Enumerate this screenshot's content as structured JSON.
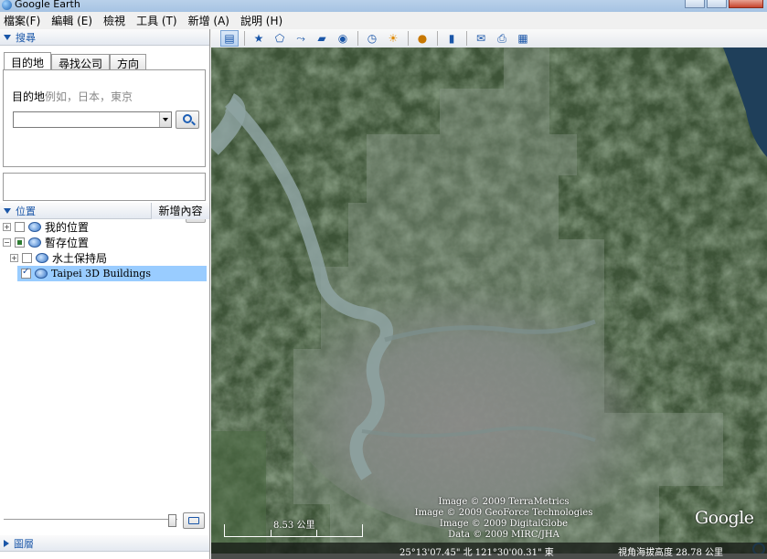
{
  "window": {
    "title": "Google Earth"
  },
  "menu": [
    "檔案(F)",
    "編輯 (E)",
    "檢視",
    "工具 (T)",
    "新增 (A)",
    "說明 (H)"
  ],
  "search": {
    "header": "搜尋",
    "tabs": [
      "目的地",
      "尋找公司",
      "方向"
    ],
    "label": "目的地",
    "hint": "例如，日本，東京",
    "input_value": ""
  },
  "places": {
    "header": "位置",
    "add_content": "新增內容",
    "items": [
      {
        "label": "我的位置",
        "expander": "+",
        "check": "none"
      },
      {
        "label": "暫存位置",
        "expander": "−",
        "check": "partial"
      },
      {
        "label": "水土保持局",
        "expander": "+",
        "check": "none"
      },
      {
        "label": "Taipei 3D Buildings",
        "expander": "",
        "check": "checked",
        "selected": true
      }
    ]
  },
  "layers": {
    "header": "圖層"
  },
  "toolbar": {
    "buttons": [
      "sidebar-toggle-icon",
      "placemark-icon",
      "polygon-icon",
      "path-icon",
      "image-overlay-icon",
      "record-tour-icon",
      "historical-imagery-icon",
      "sunlight-icon",
      "planets-icon",
      "ruler-icon",
      "email-icon",
      "print-icon",
      "view-in-maps-icon"
    ]
  },
  "map": {
    "attribution": [
      "Image © 2009 TerraMetrics",
      "Image © 2009 GeoForce Technologies",
      "Image © 2009 DigitalGlobe",
      "Data © 2009 MIRC/JHA"
    ],
    "logo": "Google",
    "scale_label": "8.53 公里"
  },
  "status": {
    "coords": "25°13'07.45\" 北    121°30'00.31\" 東",
    "eye_alt": "視角海拔高度     28.78 公里"
  },
  "colors": {
    "accent": "#1a56a8",
    "selection": "#99ccff"
  }
}
